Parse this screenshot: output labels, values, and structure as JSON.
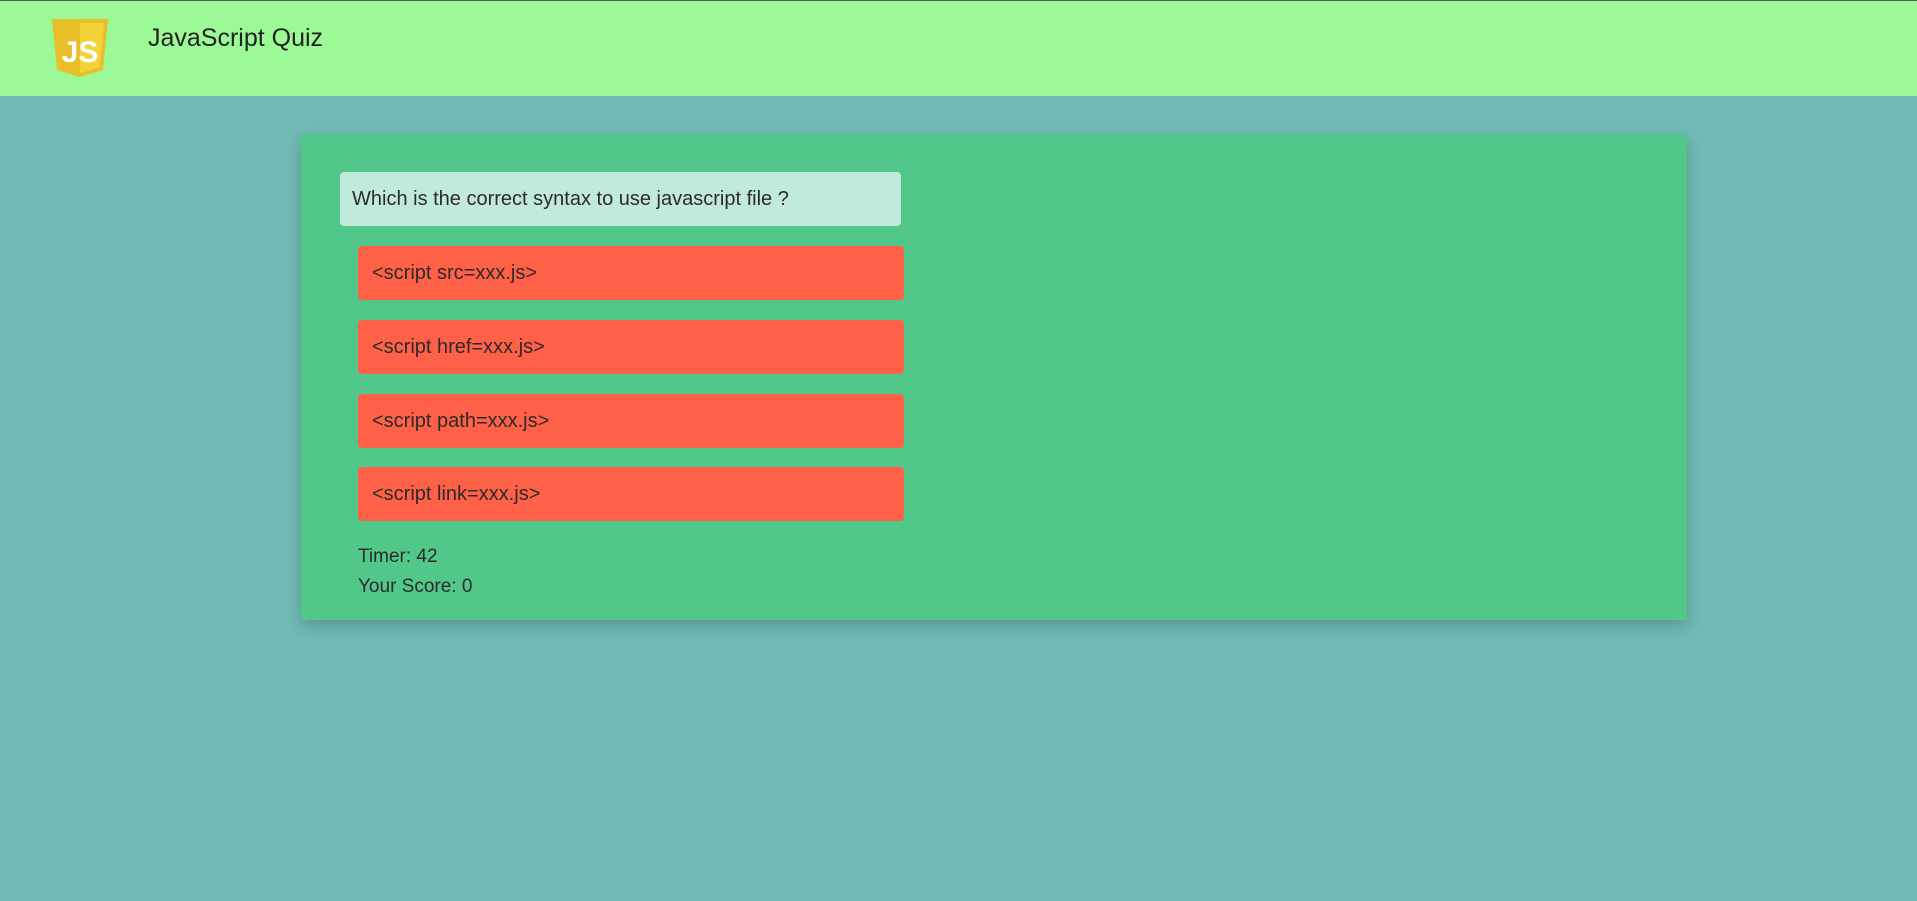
{
  "header": {
    "logo_text": "JS",
    "title": "JavaScript Quiz"
  },
  "quiz": {
    "question": "Which is the correct syntax to use javascript file ?",
    "answers": [
      "<script src=xxx.js>",
      "<script href=xxx.js>",
      "<script path=xxx.js>",
      "<script link=xxx.js>"
    ],
    "timer_label": "Timer:",
    "timer_value": "42",
    "score_label": "Your Score:",
    "score_value": "0"
  },
  "colors": {
    "background": "#70b9b4",
    "header": "#9bfa96",
    "card": "#52c78a",
    "question_box": "#c2eadc",
    "answer_button": "#ff6148",
    "logo_yellow": "#f0c82a"
  },
  "icons": {
    "logo": "js-shield-logo"
  }
}
